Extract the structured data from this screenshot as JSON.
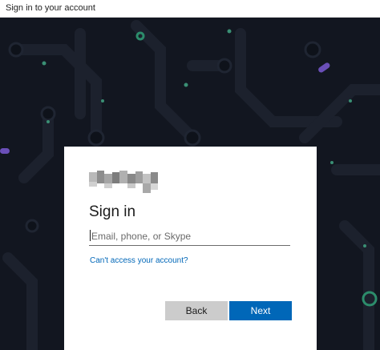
{
  "window": {
    "title": "Sign in to your account"
  },
  "signin": {
    "logo_alt": "Microsoft",
    "heading": "Sign in",
    "email_placeholder": "Email, phone, or Skype",
    "cant_access_link": "Can't access your account?",
    "back_label": "Back",
    "next_label": "Next"
  },
  "colors": {
    "background": "#121620",
    "accent": "#0067b8",
    "back_button": "#cccccc"
  },
  "icons": [
    "microsoft-logo-icon"
  ]
}
